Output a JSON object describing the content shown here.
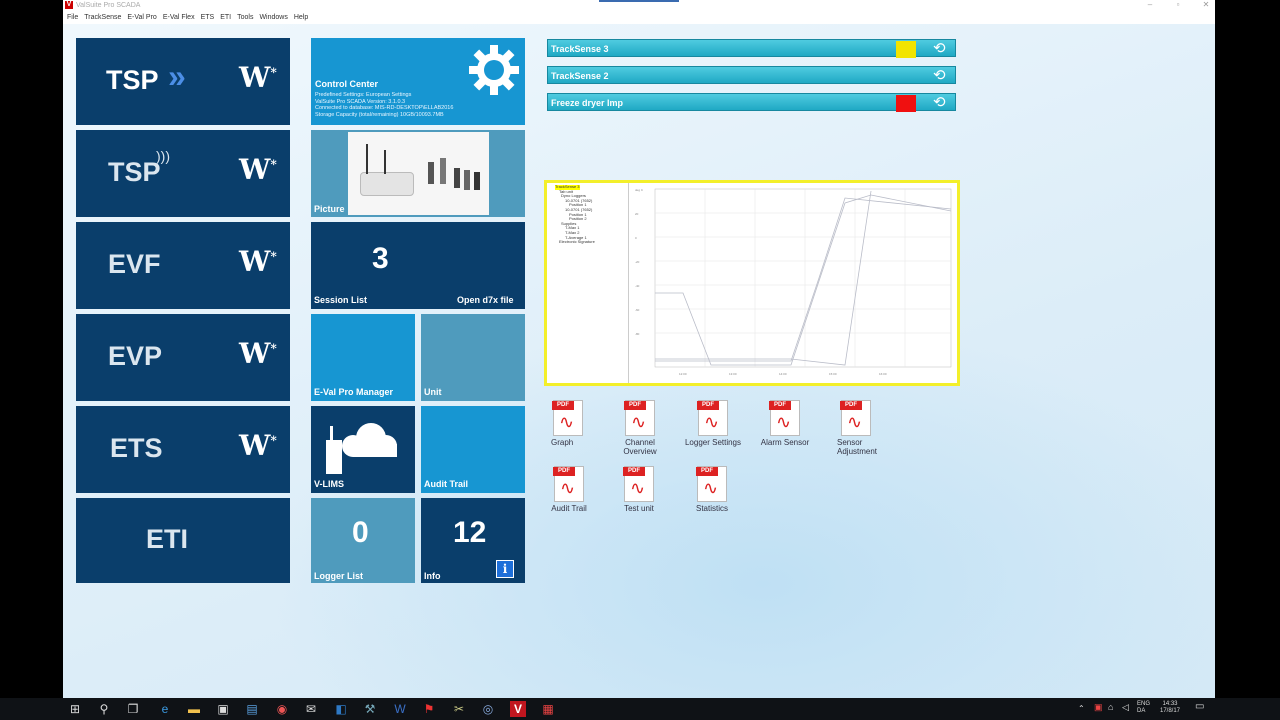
{
  "window": {
    "title": "ValSuite Pro SCADA"
  },
  "menu": [
    "File",
    "TrackSense",
    "E-Val Pro",
    "E-Val Flex",
    "ETS",
    "ETI",
    "Tools",
    "Windows",
    "Help"
  ],
  "tiles": {
    "tsp": {
      "label": "TSP",
      "arrows": "»",
      "w": "W"
    },
    "tspw": {
      "label": "TSP",
      "w": "W"
    },
    "evf": {
      "label": "EVF",
      "w": "W"
    },
    "evp": {
      "label": "EVP",
      "w": "W"
    },
    "ets": {
      "label": "ETS",
      "w": "W"
    },
    "eti": {
      "label": "ETI"
    }
  },
  "control_center": {
    "title": "Control Center",
    "lines": [
      "Predefined Settings: European Settings",
      "ValSuite Pro SCADA Version: 3.1.0.3",
      "Connected to database: MIS-RD-DESKTOP\\ELLAB2016",
      "Storage Capacity (total/remaining) 10GB/10093.7MB"
    ]
  },
  "picture_tile": {
    "label": "Picture"
  },
  "session_tile": {
    "count": "3",
    "label": "Session List",
    "open_label": "Open d7x file"
  },
  "evalpro_tile": {
    "label": "E-Val Pro Manager"
  },
  "unit_tile": {
    "label": "Unit"
  },
  "vlims_tile": {
    "label": "V-LIMS"
  },
  "audit_tile": {
    "label": "Audit Trail"
  },
  "logger_tile": {
    "count": "0",
    "label": "Logger List"
  },
  "info_tile": {
    "count": "12",
    "label": "Info"
  },
  "status_bars": [
    {
      "name": "TrackSense 3",
      "indicator": "#f2e400"
    },
    {
      "name": "TrackSense 2",
      "indicator": ""
    },
    {
      "name": "Freeze dryer Imp",
      "indicator": "#f01010"
    }
  ],
  "preview": {
    "tree_root": "TrackSense 3",
    "tree_items": [
      "Tab unit",
      "Dyno Loggers",
      "10-0701 (7652)",
      "Position 1",
      "10-0701 (7652)",
      "Position 1",
      "Position 2",
      "Supplies",
      "T-Max 1",
      "T-Max 2",
      "T-Average 1",
      "Electronic Signature"
    ]
  },
  "reports": [
    {
      "label": "Graph"
    },
    {
      "label": "Channel Overview"
    },
    {
      "label": "Logger Settings"
    },
    {
      "label": "Alarm Sensor"
    },
    {
      "label": "Sensor Adjustment"
    },
    {
      "label": "Audit Trail"
    },
    {
      "label": "Test unit"
    },
    {
      "label": "Statistics"
    }
  ],
  "pdf_tag": "PDF",
  "taskbar": {
    "lang": "ENG",
    "lang2": "DA",
    "time": "14:33",
    "date": "17/8/17"
  },
  "colors": {
    "tile": "#0a3e6b",
    "tile_light": "#1796d2",
    "tile_gray": "#4f9bbd",
    "accent_yellow": "#f2e400"
  }
}
